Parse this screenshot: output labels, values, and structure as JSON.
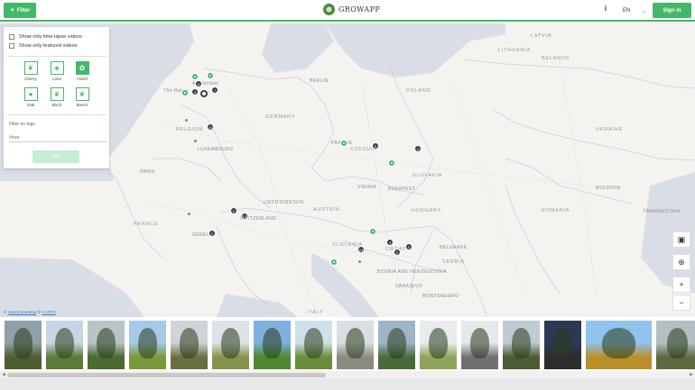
{
  "header": {
    "filter_label": "Filter",
    "brand": "GROWAPP",
    "info_label": "i",
    "language": "EN",
    "signin_label": "Sign in"
  },
  "panel": {
    "checkbox_timelapse": "Show only time-lapse videos",
    "checkbox_featured": "Show only featured videos",
    "species": [
      {
        "label": "Cherry",
        "icon": "leaf-icon",
        "active": false
      },
      {
        "label": "Lime",
        "icon": "drop-leaf-icon",
        "active": false
      },
      {
        "label": "Hazel",
        "icon": "hazel-icon",
        "active": true
      },
      {
        "label": "Oak",
        "icon": "oak-leaf-icon",
        "active": false
      },
      {
        "label": "Birch",
        "icon": "birch-leaf-icon",
        "active": false
      },
      {
        "label": "Beech",
        "icon": "beech-leaf-icon",
        "active": false
      }
    ],
    "tags_title": "Filter on tags",
    "tags_placeholder": "#tree",
    "add_label": "Add"
  },
  "map": {
    "labels": {
      "norway_sea": "",
      "latvia": "LATVIA",
      "lithuania": "LITHUANIA",
      "belarus": "BELARUS",
      "poland": "POLAND",
      "ukraine": "UKRAINE",
      "berlin": "BERLIN",
      "germany": "GERMANY",
      "czechia": "CZECHIA",
      "prague": "PRAGUE",
      "slovakia": "SLOVAKIA",
      "vienna": "VIENNA",
      "austria": "AUSTRIA",
      "hungary": "HUNGARY",
      "budapest": "BUDAPEST",
      "romania": "ROMANIA",
      "moldova": "MOLDOVA",
      "transnistria": "TRANSNISTRIA",
      "belgium": "BELGIUM",
      "luxembourg": "LUXEMBOURG",
      "paris": "PARIS",
      "france": "FRANCE",
      "switzerland": "SWITZERLAND",
      "geneva": "GENEVA",
      "liechtenstein": "LIECHTENSTEIN",
      "slovenia": "SLOVENIA",
      "croatia": "CROATIA",
      "bosnia": "BOSNIA AND HERZEGOVINA",
      "serbia": "SERBIA",
      "belgrade": "BELGRADE",
      "montenegro": "MONTENEGRO",
      "sarajevo": "SARAJEVO",
      "italy": "ITALY",
      "the_hague": "The Hague",
      "amsterdam": "Amsterdam"
    },
    "clusters": [
      "6",
      "3",
      "7",
      "11",
      "5",
      "4",
      "2",
      "12",
      "2",
      "14",
      "4",
      "2",
      "3"
    ],
    "attribution_prefix": "© ",
    "attribution_osm": "OpenStreetMap",
    "attribution_sep": " © ",
    "attribution_carto": "CARTO"
  },
  "controls": {
    "camera_icon": "camera-icon",
    "locate_icon": "locate-icon",
    "zoom_in": "+",
    "zoom_out": "−"
  },
  "thumbnails": [
    {
      "sky": "#8fa0a8",
      "ground": "#4e5e2e"
    },
    {
      "sky": "#c7d6e4",
      "ground": "#5d7a3a"
    },
    {
      "sky": "#b8c4c8",
      "ground": "#4b6a2f"
    },
    {
      "sky": "#a6c9e8",
      "ground": "#7a9a3a"
    },
    {
      "sky": "#d0d4d8",
      "ground": "#6b6f3f"
    },
    {
      "sky": "#dde3e8",
      "ground": "#86944b"
    },
    {
      "sky": "#7fb0e0",
      "ground": "#4e8a2e"
    },
    {
      "sky": "#cfe0ea",
      "ground": "#6a8e3a"
    },
    {
      "sky": "#dadfe2",
      "ground": "#8c8a80"
    },
    {
      "sky": "#a0b4c8",
      "ground": "#4a6a3a"
    },
    {
      "sky": "#e8ecef",
      "ground": "#8fa55a"
    },
    {
      "sky": "#e6e9ec",
      "ground": "#707070"
    },
    {
      "sky": "#c0cad2",
      "ground": "#4c5a36"
    },
    {
      "sky": "#2a3a55",
      "ground": "#2d2d2d"
    },
    {
      "sky": "#8fc2ec",
      "ground": "#b98f2a"
    },
    {
      "sky": "#b4bfc4",
      "ground": "#5d6a42"
    }
  ]
}
